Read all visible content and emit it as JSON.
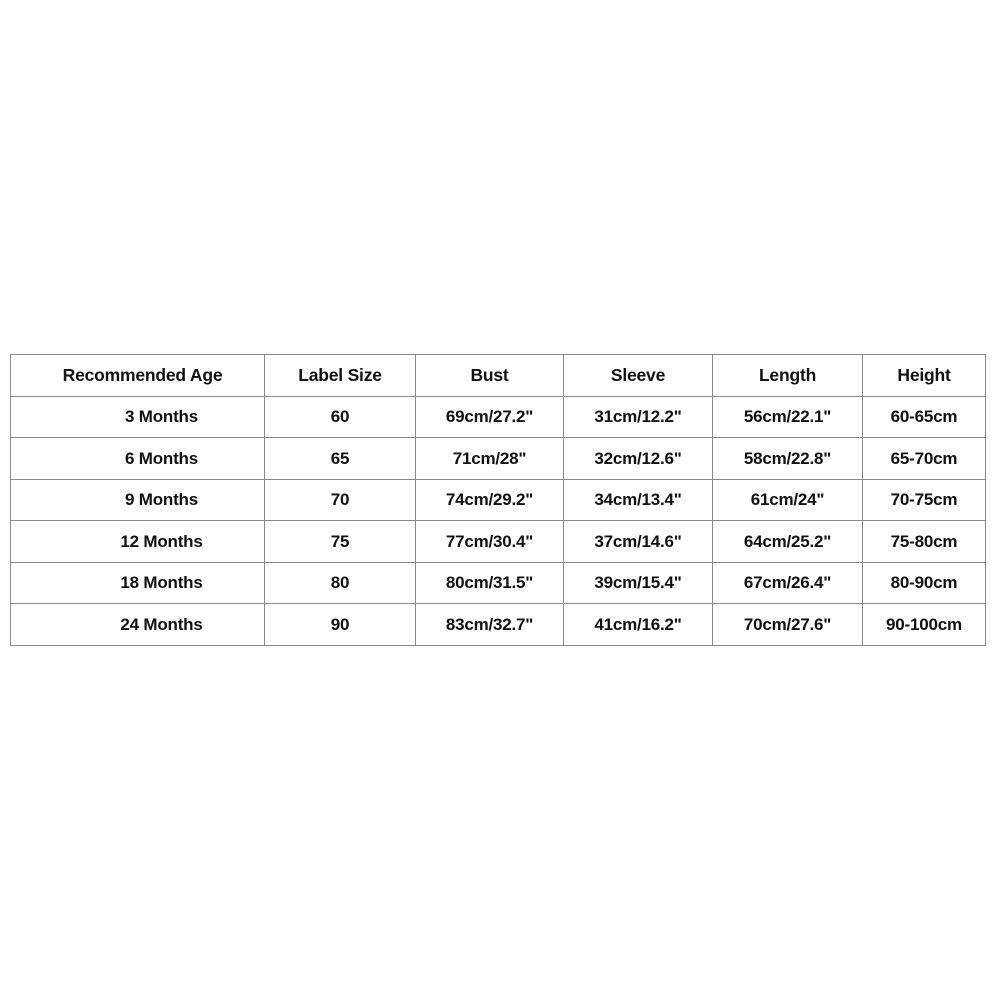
{
  "table": {
    "name": "baby-clothing-size-chart",
    "border_color": "#8a8a8a",
    "text_color": "#111111",
    "background_color": "#ffffff",
    "columns": [
      {
        "key": "age",
        "label": "Recommended Age"
      },
      {
        "key": "label",
        "label": "Label Size"
      },
      {
        "key": "bust",
        "label": "Bust"
      },
      {
        "key": "sleeve",
        "label": "Sleeve"
      },
      {
        "key": "length",
        "label": "Length"
      },
      {
        "key": "height",
        "label": "Height"
      }
    ],
    "rows": [
      {
        "age": "3 Months",
        "label": "60",
        "bust": "69cm/27.2\"",
        "sleeve": "31cm/12.2\"",
        "length": "56cm/22.1\"",
        "height": "60-65cm"
      },
      {
        "age": "6 Months",
        "label": "65",
        "bust": "71cm/28\"",
        "sleeve": "32cm/12.6\"",
        "length": "58cm/22.8\"",
        "height": "65-70cm"
      },
      {
        "age": "9 Months",
        "label": "70",
        "bust": "74cm/29.2\"",
        "sleeve": "34cm/13.4\"",
        "length": "61cm/24\"",
        "height": "70-75cm"
      },
      {
        "age": "12 Months",
        "label": "75",
        "bust": "77cm/30.4\"",
        "sleeve": "37cm/14.6\"",
        "length": "64cm/25.2\"",
        "height": "75-80cm"
      },
      {
        "age": "18 Months",
        "label": "80",
        "bust": "80cm/31.5\"",
        "sleeve": "39cm/15.4\"",
        "length": "67cm/26.4\"",
        "height": "80-90cm"
      },
      {
        "age": "24 Months",
        "label": "90",
        "bust": "83cm/32.7\"",
        "sleeve": "41cm/16.2\"",
        "length": "70cm/27.6\"",
        "height": "90-100cm"
      }
    ]
  }
}
